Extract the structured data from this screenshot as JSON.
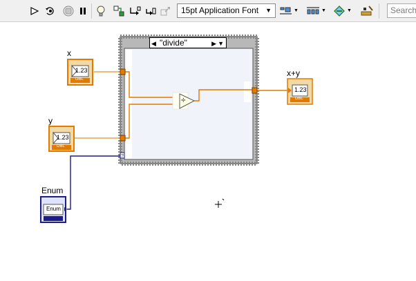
{
  "toolbar": {
    "font_select": "15pt Application Font",
    "search_placeholder": "Search",
    "icons": [
      "run-arrow-icon",
      "run-continuously-icon",
      "abort-icon",
      "pause-icon",
      "highlight-execution-icon",
      "retain-wire-values-icon",
      "step-into-icon",
      "step-over-icon",
      "step-out-icon",
      "align-objects-icon",
      "distribute-objects-icon",
      "reorder-icon",
      "cleanup-diagram-icon"
    ]
  },
  "diagram": {
    "terminals": {
      "x": {
        "label": "x",
        "type": "1.23",
        "dtype": "DBL"
      },
      "y": {
        "label": "y",
        "type": "1.23",
        "dtype": "DBL"
      },
      "sum": {
        "label": "x+y",
        "type": "1.23",
        "dtype": "DBL"
      },
      "enum": {
        "label": "Enum",
        "type": "Enum"
      }
    },
    "case_structure": {
      "selector_label": "\"divide\""
    },
    "function": {
      "symbol": "÷",
      "name": "divide-function"
    }
  },
  "colors": {
    "double_wire": "#e07a00",
    "enum_wire": "#1b1b8a",
    "structure_border": "#6e6e6e",
    "structure_bg": "#f2f4fb"
  }
}
